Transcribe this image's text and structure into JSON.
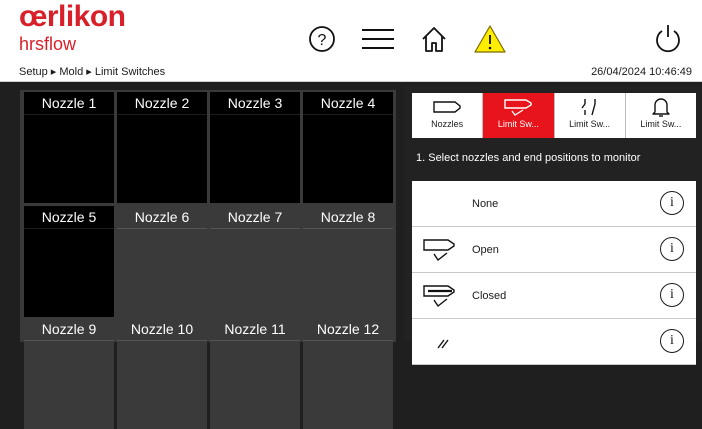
{
  "header": {
    "brand": "œrlikon",
    "brand_sub": "hrsflow",
    "breadcrumb": "Setup ▸ Mold ▸ Limit Switches",
    "datetime": "26/04/2024 10:46:49",
    "icons": [
      "help-icon",
      "menu-icon",
      "home-icon",
      "warning-icon",
      "power-icon"
    ],
    "colors": {
      "brand": "#d8202a",
      "warning": "#ffee00"
    }
  },
  "nozzles": [
    {
      "label": "Nozzle 1",
      "active": true
    },
    {
      "label": "Nozzle 2",
      "active": true
    },
    {
      "label": "Nozzle 3",
      "active": true
    },
    {
      "label": "Nozzle 4",
      "active": true
    },
    {
      "label": "Nozzle 5",
      "active": true
    },
    {
      "label": "Nozzle 6",
      "active": false
    },
    {
      "label": "Nozzle 7",
      "active": false
    },
    {
      "label": "Nozzle 8",
      "active": false
    },
    {
      "label": "Nozzle 9",
      "active": false
    },
    {
      "label": "Nozzle 10",
      "active": false
    },
    {
      "label": "Nozzle 11",
      "active": false
    },
    {
      "label": "Nozzle 12",
      "active": false
    }
  ],
  "tabs": [
    {
      "label": "Nozzles",
      "icon": "nozzle-icon",
      "selected": false
    },
    {
      "label": "Limit Sw...",
      "icon": "nozzle-check-icon",
      "selected": true
    },
    {
      "label": "Limit Sw...",
      "icon": "switch-icon",
      "selected": false
    },
    {
      "label": "Limit Sw...",
      "icon": "bell-icon",
      "selected": false
    }
  ],
  "instruction": "1. Select nozzles and end positions to monitor",
  "options": [
    {
      "label": "None",
      "icon": ""
    },
    {
      "label": "Open",
      "icon": "nozzle-open-icon"
    },
    {
      "label": "Closed",
      "icon": "nozzle-closed-icon"
    },
    {
      "label": "",
      "icon": "nozzle-both-icon"
    }
  ],
  "info_glyph": "i",
  "colors": {
    "accent": "#e8141b"
  }
}
